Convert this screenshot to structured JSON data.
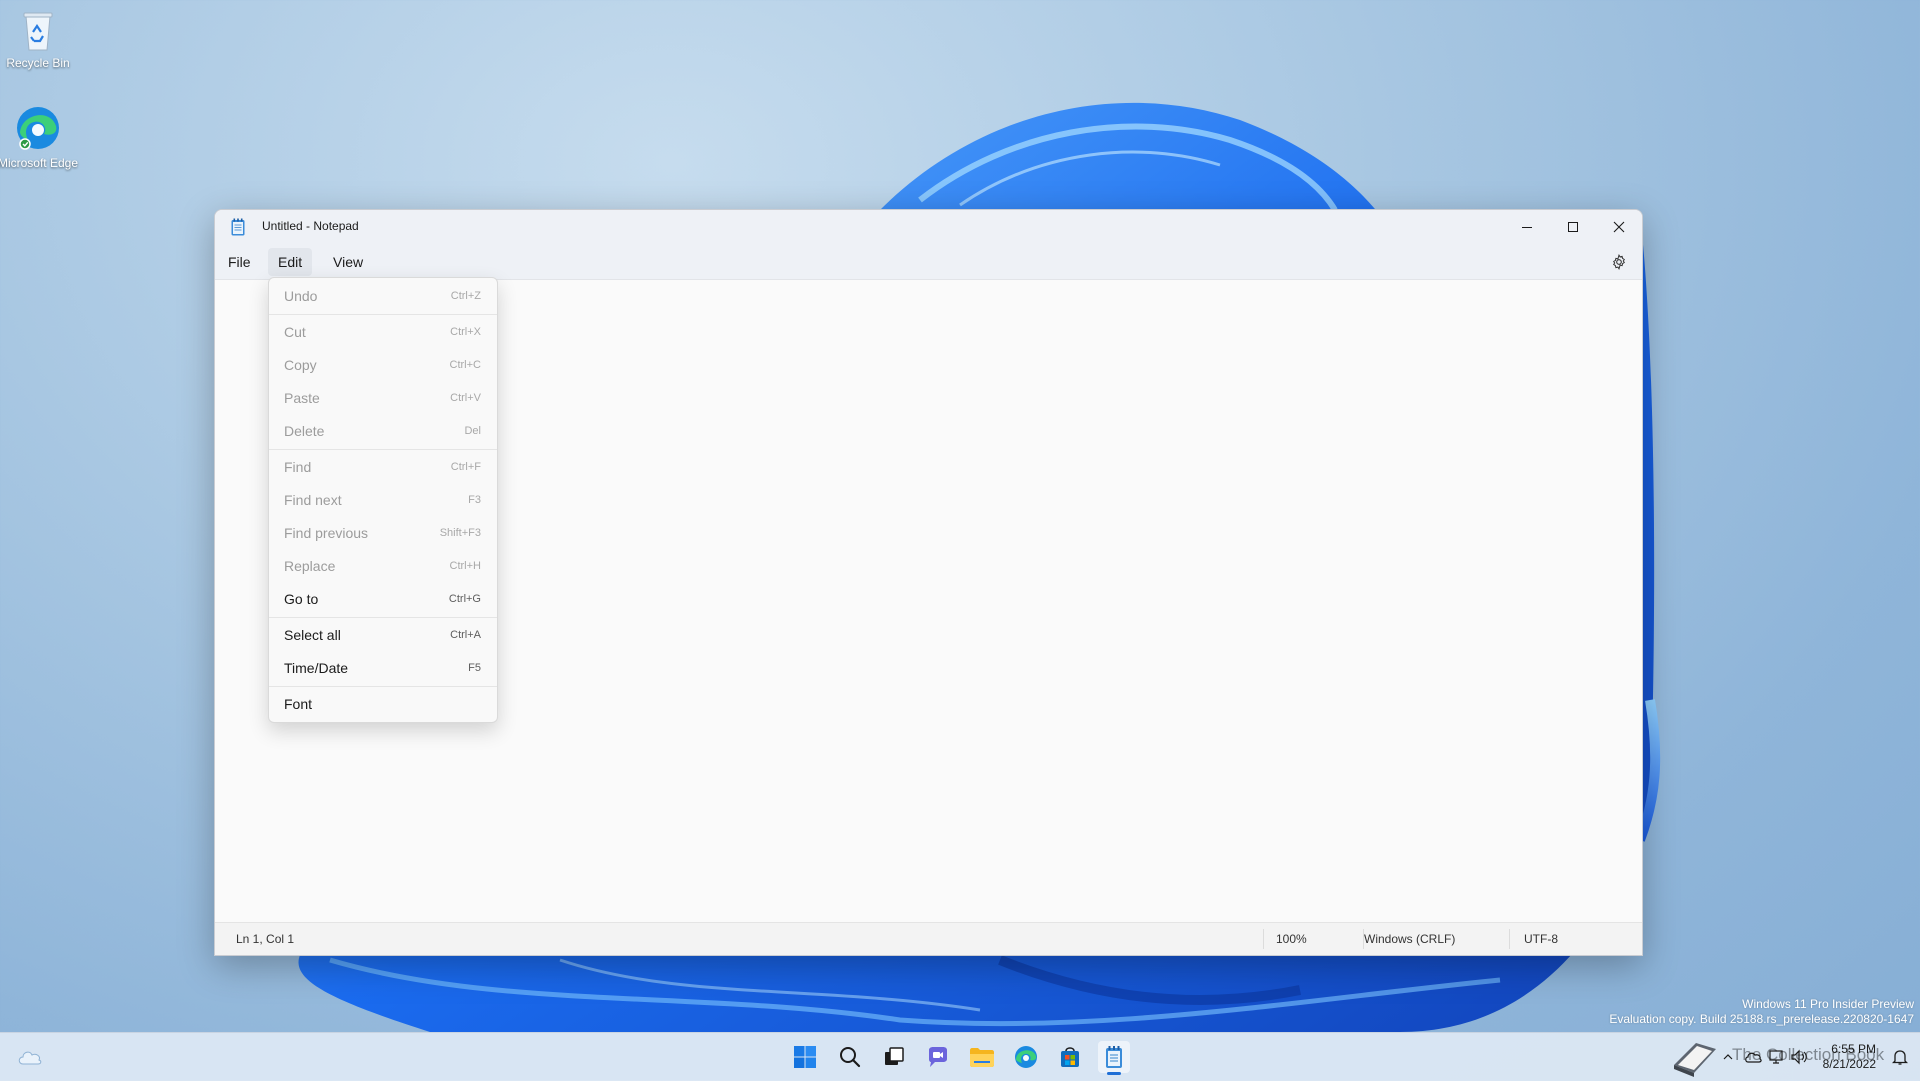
{
  "desktop": {
    "icons": [
      {
        "label": "Recycle Bin"
      },
      {
        "label": "Microsoft Edge"
      }
    ]
  },
  "window": {
    "title": "Untitled - Notepad",
    "menu": [
      {
        "label": "File"
      },
      {
        "label": "Edit"
      },
      {
        "label": "View"
      }
    ]
  },
  "edit_menu": {
    "items": [
      {
        "label": "Undo",
        "shortcut": "Ctrl+Z",
        "enabled": false
      },
      {
        "label": "Cut",
        "shortcut": "Ctrl+X",
        "enabled": false
      },
      {
        "label": "Copy",
        "shortcut": "Ctrl+C",
        "enabled": false
      },
      {
        "label": "Paste",
        "shortcut": "Ctrl+V",
        "enabled": false
      },
      {
        "label": "Delete",
        "shortcut": "Del",
        "enabled": false
      },
      {
        "label": "Find",
        "shortcut": "Ctrl+F",
        "enabled": false
      },
      {
        "label": "Find next",
        "shortcut": "F3",
        "enabled": false
      },
      {
        "label": "Find previous",
        "shortcut": "Shift+F3",
        "enabled": false
      },
      {
        "label": "Replace",
        "shortcut": "Ctrl+H",
        "enabled": false
      },
      {
        "label": "Go to",
        "shortcut": "Ctrl+G",
        "enabled": true
      },
      {
        "label": "Select all",
        "shortcut": "Ctrl+A",
        "enabled": true
      },
      {
        "label": "Time/Date",
        "shortcut": "F5",
        "enabled": true
      },
      {
        "label": "Font",
        "shortcut": "",
        "enabled": true
      }
    ]
  },
  "status_bar": {
    "position": "Ln 1, Col 1",
    "zoom": "100%",
    "line_ending": "Windows (CRLF)",
    "encoding": "UTF-8"
  },
  "watermark": {
    "line1": "Windows 11 Pro Insider Preview",
    "line2": "Evaluation copy. Build 25188.rs_prerelease.220820-1647"
  },
  "taskbar": {
    "time": "6:55 PM",
    "date": "8/21/2022",
    "overlay_text": "The Collection Book"
  },
  "colors": {
    "accent": "#1f6fd6",
    "window_bg": "#f9f9f9",
    "disabled_text": "#9c9c9c"
  }
}
